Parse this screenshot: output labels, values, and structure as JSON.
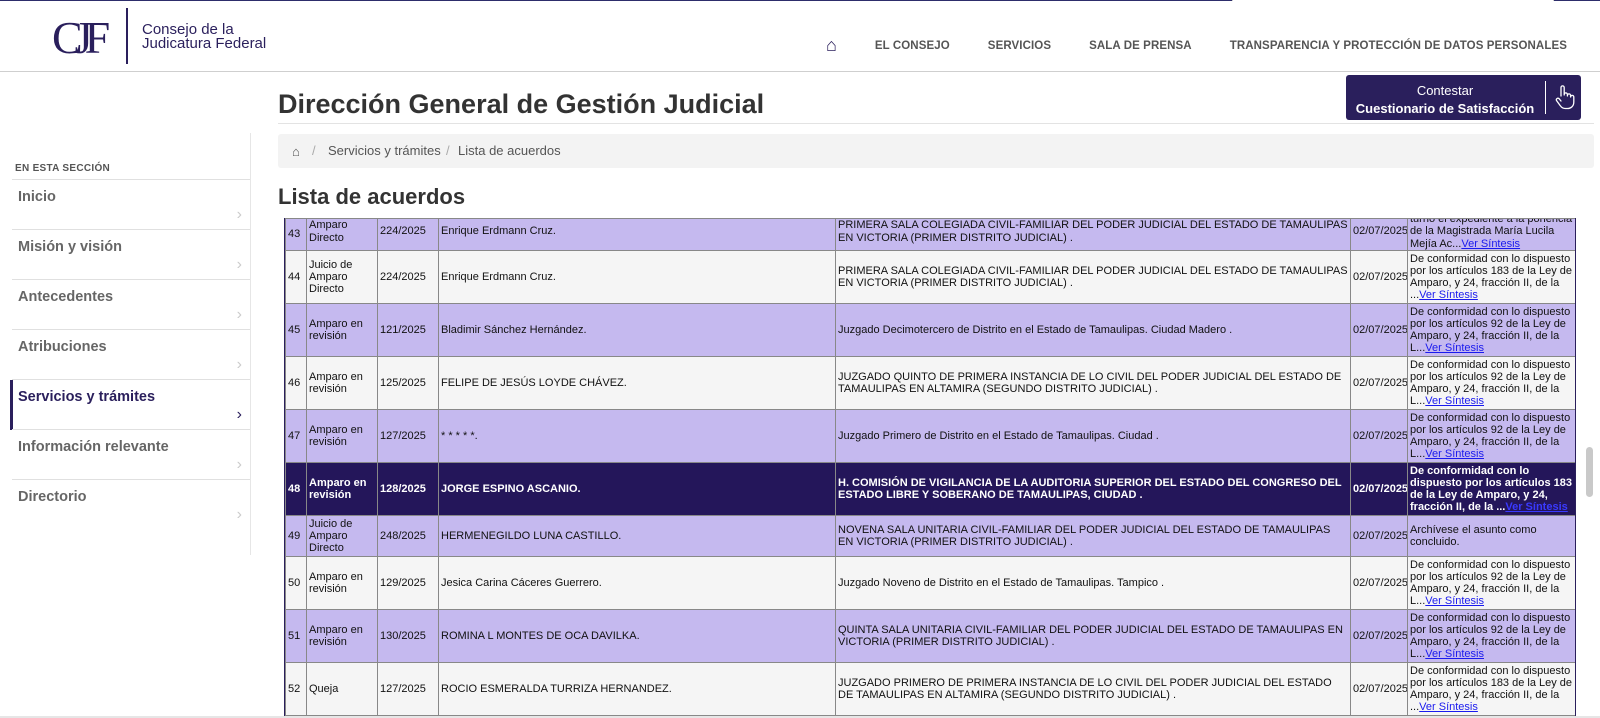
{
  "header": {
    "logo_text_line1": "Consejo de la",
    "logo_text_line2": "Judicatura Federal",
    "logo_mark": "CJF",
    "nav": [
      "EL CONSEJO",
      "SERVICIOS",
      "SALA DE PRENSA",
      "TRANSPARENCIA Y PROTECCIÓN DE DATOS PERSONALES"
    ]
  },
  "page_title": "Dirección General de Gestión Judicial",
  "survey_button": {
    "line1": "Contestar",
    "line2": "Cuestionario de Satisfacción"
  },
  "sidebar": {
    "section_label": "EN ESTA SECCIÓN",
    "items": [
      {
        "label": "Inicio"
      },
      {
        "label": "Misión y visión"
      },
      {
        "label": "Antecedentes"
      },
      {
        "label": "Atribuciones"
      },
      {
        "label": "Servicios y trámites",
        "active": true
      },
      {
        "label": "Información relevante"
      },
      {
        "label": "Directorio"
      }
    ]
  },
  "breadcrumb": [
    "Servicios y trámites",
    "Lista de acuerdos"
  ],
  "section_title": "Lista de acuerdos",
  "table": {
    "rows": [
      {
        "num": "43",
        "tipo": "Amparo Directo",
        "expediente": "224/2025",
        "parte": "Enrique Erdmann Cruz.",
        "autoridad": "PRIMERA SALA COLEGIADA CIVIL-FAMILIAR DEL PODER JUDICIAL DEL ESTADO DE TAMAULIPAS EN VICTORIA (PRIMER DISTRITO JUDICIAL) .",
        "fecha": "02/07/2025",
        "sintesis": "turno el expediente a la ponencia de la Magistrada María Lucila Mejía Ac...",
        "link": "Ver Síntesis"
      },
      {
        "num": "44",
        "tipo": "Juicio de Amparo Directo",
        "expediente": "224/2025",
        "parte": "Enrique Erdmann Cruz.",
        "autoridad": "PRIMERA SALA COLEGIADA CIVIL-FAMILIAR DEL PODER JUDICIAL DEL ESTADO DE TAMAULIPAS EN VICTORIA (PRIMER DISTRITO JUDICIAL) .",
        "fecha": "02/07/2025",
        "sintesis": "De conformidad con lo dispuesto por los artículos 183 de la Ley de Amparo, y 24, fracción II, de la ...",
        "link": "Ver Síntesis"
      },
      {
        "num": "45",
        "tipo": "Amparo en revisión",
        "expediente": "121/2025",
        "parte": "Bladimir Sánchez Hernández.",
        "autoridad": "Juzgado Decimotercero de Distrito en el Estado de Tamaulipas. Ciudad Madero .",
        "fecha": "02/07/2025",
        "sintesis": "De conformidad con lo dispuesto por los artículos 92 de la Ley de Amparo, y 24, fracción II, de la L...",
        "link": "Ver Síntesis"
      },
      {
        "num": "46",
        "tipo": "Amparo en revisión",
        "expediente": "125/2025",
        "parte": "FELIPE DE JESÚS LOYDE CHÁVEZ.",
        "autoridad": "JUZGADO QUINTO DE PRIMERA INSTANCIA DE LO CIVIL DEL PODER JUDICIAL DEL ESTADO DE TAMAULIPAS EN ALTAMIRA (SEGUNDO DISTRITO JUDICIAL) .",
        "fecha": "02/07/2025",
        "sintesis": "De conformidad con lo dispuesto por los artículos 92 de la Ley de Amparo, y 24, fracción II, de la L...",
        "link": "Ver Síntesis"
      },
      {
        "num": "47",
        "tipo": "Amparo en revisión",
        "expediente": "127/2025",
        "parte": "* * * * *.",
        "autoridad": "Juzgado Primero de Distrito en el Estado de Tamaulipas. Ciudad .",
        "fecha": "02/07/2025",
        "sintesis": "De conformidad con lo dispuesto por los artículos 92 de la Ley de Amparo, y 24, fracción II, de la L...",
        "link": "Ver Síntesis"
      },
      {
        "num": "48",
        "tipo": "Amparo en revisión",
        "expediente": "128/2025",
        "parte": "JORGE ESPINO ASCANIO.",
        "autoridad": "H. COMISIÓN DE VIGILANCIA DE LA AUDITORIA SUPERIOR DEL ESTADO DEL CONGRESO DEL ESTADO LIBRE Y SOBERANO DE TAMAULIPAS, CIUDAD .",
        "fecha": "02/07/2025",
        "sintesis": "De conformidad con lo dispuesto por los artículos 183 de la Ley de Amparo, y 24, fracción II, de la ...",
        "link": "Ver Síntesis",
        "highlight": true
      },
      {
        "num": "49",
        "tipo": "Juicio de Amparo Directo",
        "expediente": "248/2025",
        "parte": "HERMENEGILDO LUNA CASTILLO.",
        "autoridad": "NOVENA SALA UNITARIA CIVIL-FAMILIAR DEL PODER JUDICIAL DEL ESTADO DE TAMAULIPAS EN VICTORIA (PRIMER DISTRITO JUDICIAL) .",
        "fecha": "02/07/2025",
        "sintesis": "Archívese el asunto como concluido.",
        "link": ""
      },
      {
        "num": "50",
        "tipo": "Amparo en revisión",
        "expediente": "129/2025",
        "parte": "Jesica Carina Cáceres Guerrero.",
        "autoridad": "Juzgado Noveno de Distrito en el Estado de Tamaulipas. Tampico .",
        "fecha": "02/07/2025",
        "sintesis": "De conformidad con lo dispuesto por los artículos 92 de la Ley de Amparo, y 24, fracción II, de la L...",
        "link": "Ver Síntesis"
      },
      {
        "num": "51",
        "tipo": "Amparo en revisión",
        "expediente": "130/2025",
        "parte": "ROMINA L MONTES DE OCA DAVILKA.",
        "autoridad": "QUINTA SALA UNITARIA CIVIL-FAMILIAR DEL PODER JUDICIAL DEL ESTADO DE TAMAULIPAS EN VICTORIA (PRIMER DISTRITO JUDICIAL) .",
        "fecha": "02/07/2025",
        "sintesis": "De conformidad con lo dispuesto por los artículos 92 de la Ley de Amparo, y 24, fracción II, de la L...",
        "link": "Ver Síntesis"
      },
      {
        "num": "52",
        "tipo": "Queja",
        "expediente": "127/2025",
        "parte": "ROCIO ESMERALDA TURRIZA HERNANDEZ.",
        "autoridad": "JUZGADO PRIMERO DE PRIMERA INSTANCIA DE LO CIVIL DEL PODER JUDICIAL DEL ESTADO DE TAMAULIPAS EN ALTAMIRA (SEGUNDO DISTRITO JUDICIAL) .",
        "fecha": "02/07/2025",
        "sintesis": "De conformidad con lo dispuesto por los artículos 183 de la Ley de Amparo, y 24, fracción II, de la ...",
        "link": "Ver Síntesis"
      }
    ]
  },
  "colors": {
    "brand": "#2a1f5c",
    "row_alt": "#c5b9ef",
    "row_light": "#f5f5f5",
    "row_highlight": "#24165a",
    "link": "#1a1aee"
  },
  "icons": {
    "home": "home-icon",
    "chevron": "chevron-right-icon",
    "survey": "hand-pointer-icon"
  }
}
